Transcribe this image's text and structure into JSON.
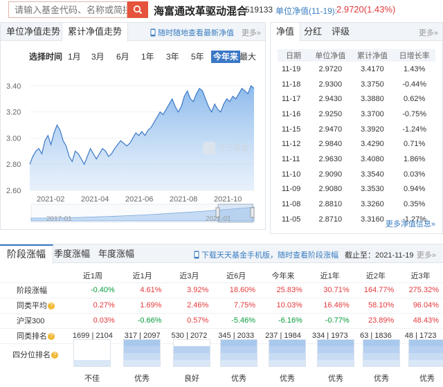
{
  "header": {
    "search_placeholder": "请输入基金代码、名称或简拼",
    "fund_name": "海富通改革驱动混合",
    "fund_code": "519133",
    "nav_label": "单位净值(11-19):",
    "nav_value": "2.9720(1.43%)"
  },
  "chart_panel": {
    "tabs": [
      "单位净值走势",
      "累计净值走势"
    ],
    "active_tab": 1,
    "promo": "随时随地查看最新净值",
    "more": "更多»",
    "range_title": "选择时间",
    "ranges": [
      "1月",
      "3月",
      "6月",
      "1年",
      "3年",
      "5年",
      "今年来",
      "最大"
    ],
    "selected_range": "今年来",
    "watermark": "天天基金"
  },
  "chart_data": {
    "type": "area",
    "title": "",
    "xlabel": "",
    "ylabel": "",
    "ylim": [
      2.6,
      3.5
    ],
    "yticks": [
      "3.40",
      "3.20",
      "3.00",
      "2.80",
      "2.60"
    ],
    "xticks": [
      "2021-02",
      "2021-04",
      "2021-06",
      "2021-08",
      "2021-10"
    ],
    "values": [
      2.8,
      2.86,
      2.9,
      2.92,
      2.88,
      2.98,
      3.02,
      2.95,
      3.04,
      3.1,
      3.06,
      2.98,
      2.94,
      2.86,
      2.82,
      2.9,
      2.88,
      2.84,
      2.8,
      2.86,
      2.92,
      2.88,
      2.84,
      2.88,
      2.92,
      2.9,
      2.86,
      2.88,
      2.92,
      2.95,
      2.98,
      2.96,
      2.94,
      2.96,
      3.0,
      3.04,
      3.02,
      3.05,
      3.02,
      3.06,
      3.08,
      3.12,
      3.16,
      3.2,
      3.18,
      3.22,
      3.26,
      3.3,
      3.24,
      3.2,
      3.24,
      3.32,
      3.36,
      3.3,
      3.28,
      3.34,
      3.38,
      3.36,
      3.3,
      3.24,
      3.2,
      3.26,
      3.22,
      3.2,
      3.26,
      3.3,
      3.28,
      3.32,
      3.3,
      3.34,
      3.38,
      3.36,
      3.34,
      3.4,
      3.38
    ],
    "navigator_labels": [
      "2017-01",
      "2021-01"
    ]
  },
  "nav_panel": {
    "tabs": [
      "净值",
      "分红",
      "评级"
    ],
    "more": "更多»",
    "headers": [
      "日期",
      "单位净值",
      "累计净值",
      "日增长率"
    ],
    "rows": [
      [
        "11-19",
        "2.9720",
        "3.4170",
        "1.43%"
      ],
      [
        "11-18",
        "2.9300",
        "3.3750",
        "-0.44%"
      ],
      [
        "11-17",
        "2.9430",
        "3.3880",
        "0.62%"
      ],
      [
        "11-16",
        "2.9250",
        "3.3700",
        "-0.75%"
      ],
      [
        "11-15",
        "2.9470",
        "3.3920",
        "-1.24%"
      ],
      [
        "11-12",
        "2.9840",
        "3.4290",
        "0.71%"
      ],
      [
        "11-11",
        "2.9630",
        "3.4080",
        "1.86%"
      ],
      [
        "11-10",
        "2.9090",
        "3.3540",
        "0.03%"
      ],
      [
        "11-09",
        "2.9080",
        "3.3530",
        "0.94%"
      ],
      [
        "11-08",
        "2.8810",
        "3.3260",
        "0.35%"
      ],
      [
        "11-05",
        "2.8710",
        "3.3160",
        "-1.27%"
      ]
    ],
    "more_nav": "更多净值信息»"
  },
  "performance": {
    "tabs": [
      "阶段涨幅",
      "季度涨幅",
      "年度涨幅"
    ],
    "promo": "下载天天基金手机版，随时查看阶段涨幅",
    "date_label": "截止至：2021-11-19",
    "more": "更多»",
    "columns": [
      "近1周",
      "近1月",
      "近3月",
      "近6月",
      "今年来",
      "近1年",
      "近2年",
      "近3年"
    ],
    "rows": [
      {
        "label": "阶段涨幅",
        "values": [
          "-0.40%",
          "4.61%",
          "3.92%",
          "18.60%",
          "25.83%",
          "30.71%",
          "164.77%",
          "275.32%"
        ]
      },
      {
        "label": "同类平均",
        "values": [
          "0.27%",
          "1.69%",
          "2.46%",
          "7.75%",
          "10.03%",
          "16.46%",
          "58.10%",
          "96.04%"
        ]
      },
      {
        "label": "沪深300",
        "values": [
          "0.03%",
          "-0.66%",
          "0.57%",
          "-5.46%",
          "-6.16%",
          "-0.77%",
          "23.89%",
          "48.43%"
        ]
      }
    ],
    "rank_label": "同类排名",
    "ranks": [
      "1699 | 2104",
      "317 | 2097",
      "530 | 2072",
      "345 | 2033",
      "237 | 1984",
      "334 | 1973",
      "63 | 1836",
      "48 | 1723"
    ],
    "quartile_label": "四分位排名",
    "quartiles": [
      "不佳",
      "优秀",
      "良好",
      "优秀",
      "优秀",
      "优秀",
      "优秀",
      "优秀"
    ],
    "quartile_levels": [
      1,
      4,
      3,
      4,
      4,
      4,
      4,
      4
    ]
  },
  "colors": {
    "accent": "#3b78c6",
    "up": "#e4393c",
    "down": "#079b3c",
    "brand": "#e4533b"
  }
}
